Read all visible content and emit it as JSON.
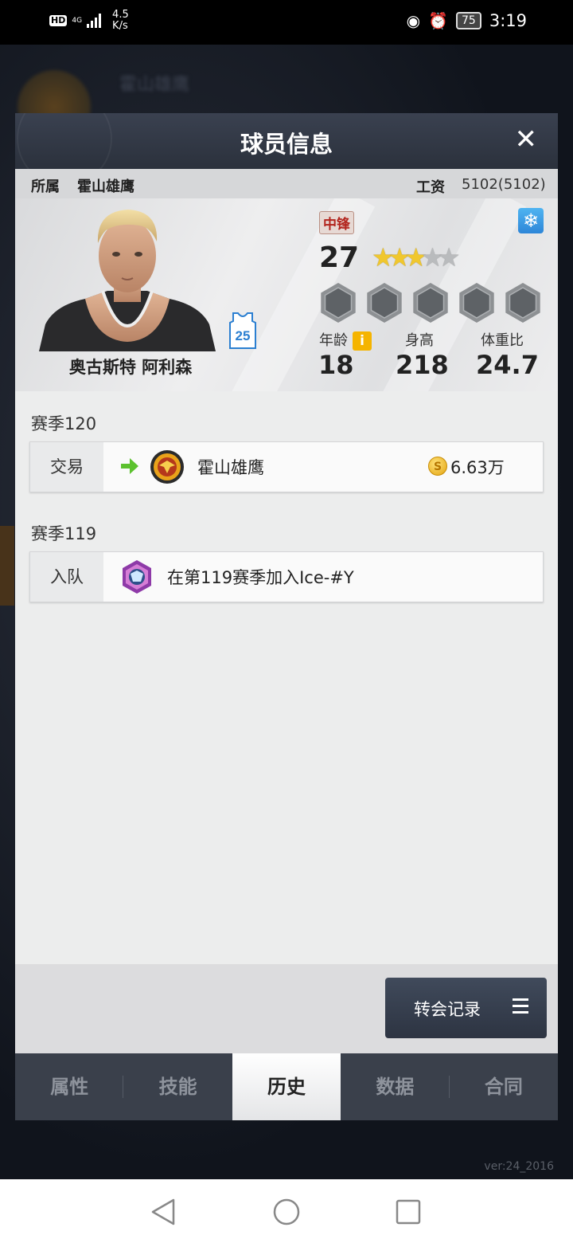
{
  "status_bar": {
    "hd_badge": "HD",
    "network": "4G",
    "speed_value": "4.5",
    "speed_unit": "K/s",
    "battery": "75",
    "time": "3:19"
  },
  "dialog": {
    "title": "球员信息",
    "close_glyph": "✕"
  },
  "info_bar": {
    "team_label": "所属",
    "team_name": "霍山雄鹰",
    "salary_label": "工资",
    "salary_value": "5102(5102)"
  },
  "player": {
    "name": "奥古斯特 阿利森",
    "jersey_number": "25",
    "position": "中锋",
    "overall": "27",
    "stars_filled": 3,
    "stars_total": 5,
    "badge_count": 5,
    "stats": {
      "age_label": "年龄",
      "age_value": "18",
      "height_label": "身高",
      "height_value": "218",
      "weight_label": "体重比",
      "weight_value": "24.7"
    },
    "info_icon": "i",
    "snow_icon": "❄"
  },
  "history": [
    {
      "season": "赛季120",
      "type": "交易",
      "text": "霍山雄鹰",
      "coin_symbol": "S",
      "amount": "6.63万"
    },
    {
      "season": "赛季119",
      "type": "入队",
      "text": "在第119赛季加入Ice-#Y"
    }
  ],
  "transfer_button": {
    "label": "转会记录"
  },
  "tabs": [
    {
      "label": "属性",
      "active": false
    },
    {
      "label": "技能",
      "active": false
    },
    {
      "label": "历史",
      "active": true
    },
    {
      "label": "数据",
      "active": false
    },
    {
      "label": "合同",
      "active": false
    }
  ],
  "background": {
    "title": "霍山雄鹰"
  },
  "version": "ver:24_2016",
  "colors": {
    "header": "#343a46",
    "accent_gold": "#f0c72e",
    "position_red": "#b3261f",
    "arrow_green": "#5cc12e",
    "active_tab": "#ffffff"
  }
}
